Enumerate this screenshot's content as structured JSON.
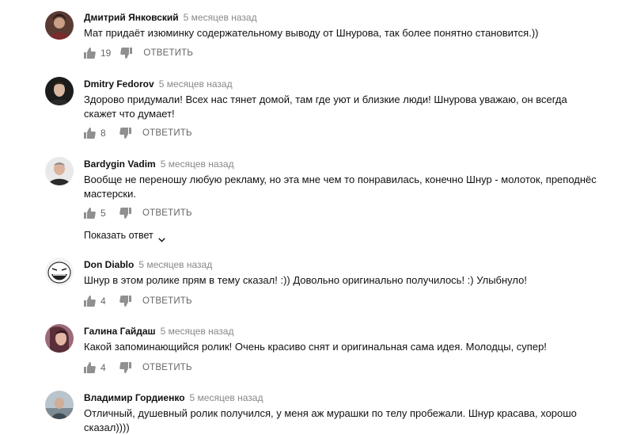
{
  "comments": [
    {
      "author": "Дмитрий Янковский",
      "time": "5 месяцев назад",
      "text": "Мат придаёт изюминку содержательному выводу от Шнурова, так более понятно становится.))",
      "likes": "19",
      "reply_label": "ОТВЕТИТЬ"
    },
    {
      "author": "Dmitry Fedorov",
      "time": "5 месяцев назад",
      "text": "Здорово придумали! Всех нас тянет домой, там где уют и близкие люди! Шнурова уважаю, он всегда скажет что думает!",
      "likes": "8",
      "reply_label": "ОТВЕТИТЬ"
    },
    {
      "author": "Bardygin Vadim",
      "time": "5 месяцев назад",
      "text": "Вообще не переношу любую рекламу, но эта мне чем то понравилась, конечно Шнур - молоток, преподнёс мастерски.",
      "likes": "5",
      "reply_label": "ОТВЕТИТЬ",
      "show_replies": "Показать ответ"
    },
    {
      "author": "Don Diablo",
      "time": "5 месяцев назад",
      "text": "Шнур в этом ролике прям в тему сказал! :)) Довольно оригинально получилось! :) Улыбнуло!",
      "likes": "4",
      "reply_label": "ОТВЕТИТЬ"
    },
    {
      "author": "Галина Гайдаш",
      "time": "5 месяцев назад",
      "text": "Какой запоминающийся ролик! Очень красиво снят и оригинальная сама идея. Молодцы, супер!",
      "likes": "4",
      "reply_label": "ОТВЕТИТЬ"
    },
    {
      "author": "Владимир Гордиенко",
      "time": "5 месяцев назад",
      "text": "Отличный, душевный ролик получился, у меня аж мурашки по телу пробежали. Шнур красава, хорошо сказал))))"
    }
  ],
  "icons": {
    "like": "thumbs-up-icon",
    "dislike": "thumbs-down-icon",
    "chevron": "chevron-down-icon"
  },
  "colors": {
    "text": "#111111",
    "meta": "#888888",
    "icon": "#909090"
  }
}
